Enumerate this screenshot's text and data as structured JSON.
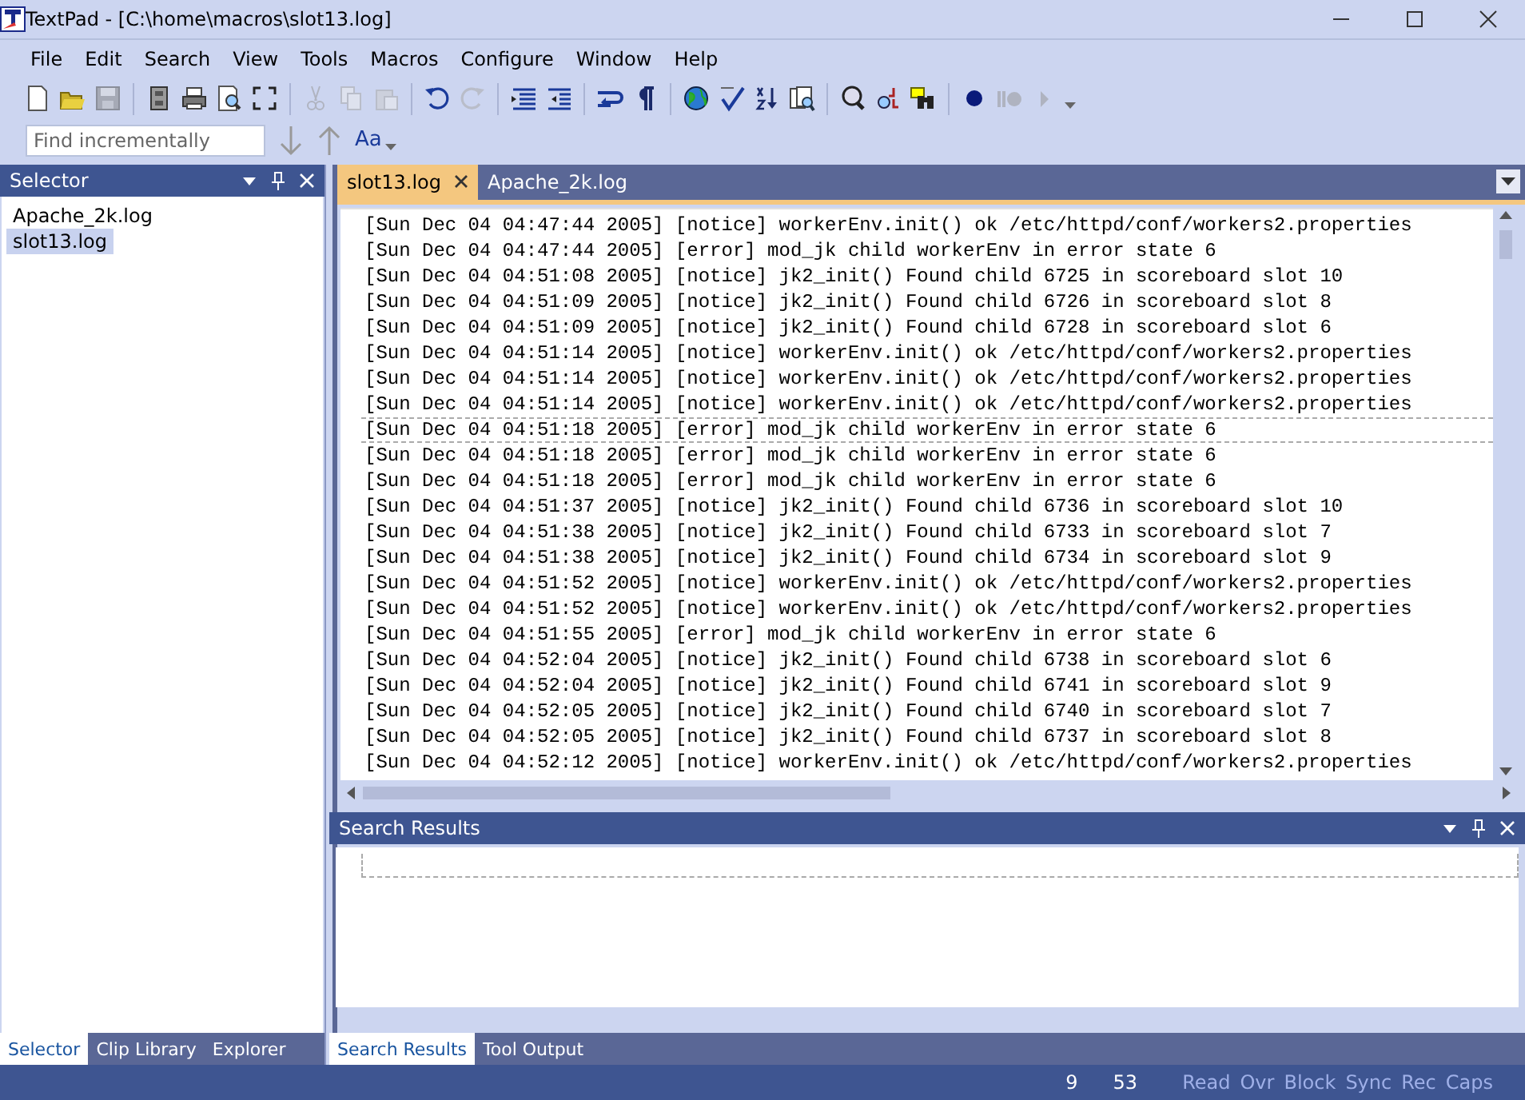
{
  "window": {
    "title": "TextPad - [C:\\home\\macros\\slot13.log]"
  },
  "menu": [
    "File",
    "Edit",
    "Search",
    "View",
    "Tools",
    "Macros",
    "Configure",
    "Window",
    "Help"
  ],
  "toolbar": [
    {
      "disabled": false
    },
    {
      "disabled": false
    },
    {
      "disabled": true
    },
    {
      "disabled": false
    },
    {
      "disabled": false
    },
    {
      "disabled": false
    },
    {
      "disabled": false
    },
    {
      "disabled": true
    },
    {
      "disabled": true
    },
    {
      "disabled": true
    },
    {
      "disabled": false
    },
    {
      "disabled": true
    },
    {
      "disabled": false
    },
    {
      "disabled": false
    },
    {
      "disabled": false
    },
    {
      "disabled": false
    },
    {
      "disabled": false
    },
    {
      "disabled": false
    },
    {
      "disabled": false
    },
    {
      "disabled": false
    },
    {
      "disabled": false
    },
    {
      "disabled": false
    },
    {
      "disabled": false
    },
    {
      "disabled": false
    },
    {
      "disabled": true
    },
    {
      "disabled": true
    }
  ],
  "find": {
    "placeholder": "Find incrementally",
    "case_button": "Aa"
  },
  "selector": {
    "title": "Selector",
    "items": [
      {
        "label": "Apache_2k.log",
        "selected": false
      },
      {
        "label": "slot13.log",
        "selected": true
      }
    ],
    "tabs": [
      {
        "label": "Selector",
        "selected": true
      },
      {
        "label": "Clip Library",
        "selected": false
      },
      {
        "label": "Explorer",
        "selected": false
      }
    ]
  },
  "doc_tabs": [
    {
      "label": "slot13.log",
      "selected": true
    },
    {
      "label": "Apache_2k.log",
      "selected": false
    }
  ],
  "editor": {
    "lines": [
      {
        "text": "[Sun Dec 04 04:47:44 2005] [notice] workerEnv.init() ok /etc/httpd/conf/workers2.properties",
        "current": false
      },
      {
        "text": "[Sun Dec 04 04:47:44 2005] [error] mod_jk child workerEnv in error state 6",
        "current": false
      },
      {
        "text": "[Sun Dec 04 04:51:08 2005] [notice] jk2_init() Found child 6725 in scoreboard slot 10",
        "current": false
      },
      {
        "text": "[Sun Dec 04 04:51:09 2005] [notice] jk2_init() Found child 6726 in scoreboard slot 8",
        "current": false
      },
      {
        "text": "[Sun Dec 04 04:51:09 2005] [notice] jk2_init() Found child 6728 in scoreboard slot 6",
        "current": false
      },
      {
        "text": "[Sun Dec 04 04:51:14 2005] [notice] workerEnv.init() ok /etc/httpd/conf/workers2.properties",
        "current": false
      },
      {
        "text": "[Sun Dec 04 04:51:14 2005] [notice] workerEnv.init() ok /etc/httpd/conf/workers2.properties",
        "current": false
      },
      {
        "text": "[Sun Dec 04 04:51:14 2005] [notice] workerEnv.init() ok /etc/httpd/conf/workers2.properties",
        "current": false
      },
      {
        "text": "[Sun Dec 04 04:51:18 2005] [error] mod_jk child workerEnv in error state 6",
        "current": true
      },
      {
        "text": "[Sun Dec 04 04:51:18 2005] [error] mod_jk child workerEnv in error state 6",
        "current": false
      },
      {
        "text": "[Sun Dec 04 04:51:18 2005] [error] mod_jk child workerEnv in error state 6",
        "current": false
      },
      {
        "text": "[Sun Dec 04 04:51:37 2005] [notice] jk2_init() Found child 6736 in scoreboard slot 10",
        "current": false
      },
      {
        "text": "[Sun Dec 04 04:51:38 2005] [notice] jk2_init() Found child 6733 in scoreboard slot 7",
        "current": false
      },
      {
        "text": "[Sun Dec 04 04:51:38 2005] [notice] jk2_init() Found child 6734 in scoreboard slot 9",
        "current": false
      },
      {
        "text": "[Sun Dec 04 04:51:52 2005] [notice] workerEnv.init() ok /etc/httpd/conf/workers2.properties",
        "current": false
      },
      {
        "text": "[Sun Dec 04 04:51:52 2005] [notice] workerEnv.init() ok /etc/httpd/conf/workers2.properties",
        "current": false
      },
      {
        "text": "[Sun Dec 04 04:51:55 2005] [error] mod_jk child workerEnv in error state 6",
        "current": false
      },
      {
        "text": "[Sun Dec 04 04:52:04 2005] [notice] jk2_init() Found child 6738 in scoreboard slot 6",
        "current": false
      },
      {
        "text": "[Sun Dec 04 04:52:04 2005] [notice] jk2_init() Found child 6741 in scoreboard slot 9",
        "current": false
      },
      {
        "text": "[Sun Dec 04 04:52:05 2005] [notice] jk2_init() Found child 6740 in scoreboard slot 7",
        "current": false
      },
      {
        "text": "[Sun Dec 04 04:52:05 2005] [notice] jk2_init() Found child 6737 in scoreboard slot 8",
        "current": false
      },
      {
        "text": "[Sun Dec 04 04:52:12 2005] [notice] workerEnv.init() ok /etc/httpd/conf/workers2.properties",
        "current": false
      }
    ]
  },
  "results": {
    "title": "Search Results",
    "tabs": [
      {
        "label": "Search Results",
        "selected": true
      },
      {
        "label": "Tool Output",
        "selected": false
      }
    ]
  },
  "status_bar": {
    "line": "9",
    "column": "53",
    "indicators": [
      {
        "label": "Read",
        "on": false
      },
      {
        "label": "Ovr",
        "on": false
      },
      {
        "label": "Block",
        "on": false
      },
      {
        "label": "Sync",
        "on": false
      },
      {
        "label": "Rec",
        "on": false
      },
      {
        "label": "Caps",
        "on": false
      }
    ]
  }
}
